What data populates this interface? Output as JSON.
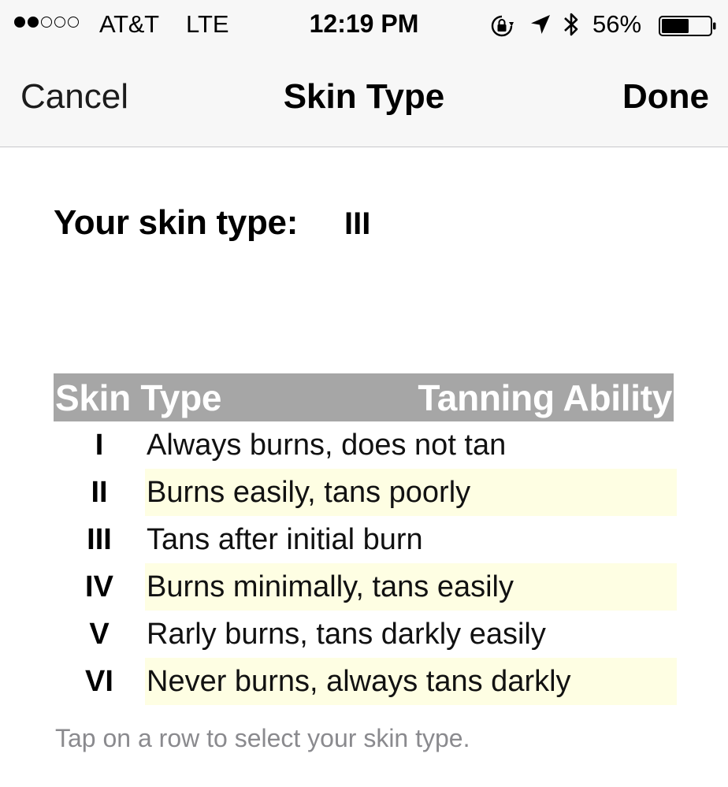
{
  "status_bar": {
    "signal_dots_filled": 2,
    "signal_dots_total": 5,
    "carrier": "AT&T",
    "network": "LTE",
    "time": "12:19 PM",
    "icons": [
      "orientation-lock-icon",
      "location-arrow-icon",
      "bluetooth-icon"
    ],
    "battery_percent_text": "56%",
    "battery_level": 0.56
  },
  "nav": {
    "cancel_label": "Cancel",
    "title": "Skin Type",
    "done_label": "Done"
  },
  "selection": {
    "label": "Your skin type:",
    "value": "III"
  },
  "table": {
    "header": {
      "type_col": "Skin Type",
      "ability_col": "Tanning Ability",
      "background": "#a6a6a6"
    },
    "rows": [
      {
        "type": "I",
        "ability": "Always burns, does not tan",
        "highlight": false
      },
      {
        "type": "II",
        "ability": "Burns easily, tans poorly",
        "highlight": true
      },
      {
        "type": "III",
        "ability": "Tans after initial burn",
        "highlight": false
      },
      {
        "type": "IV",
        "ability": "Burns minimally, tans easily",
        "highlight": true
      },
      {
        "type": "V",
        "ability": "Rarly burns, tans darkly easily",
        "highlight": false
      },
      {
        "type": "VI",
        "ability": "Never burns, always tans darkly",
        "highlight": true
      }
    ],
    "highlight_color": "#fefee3"
  },
  "hint": "Tap on a row to select your skin type."
}
